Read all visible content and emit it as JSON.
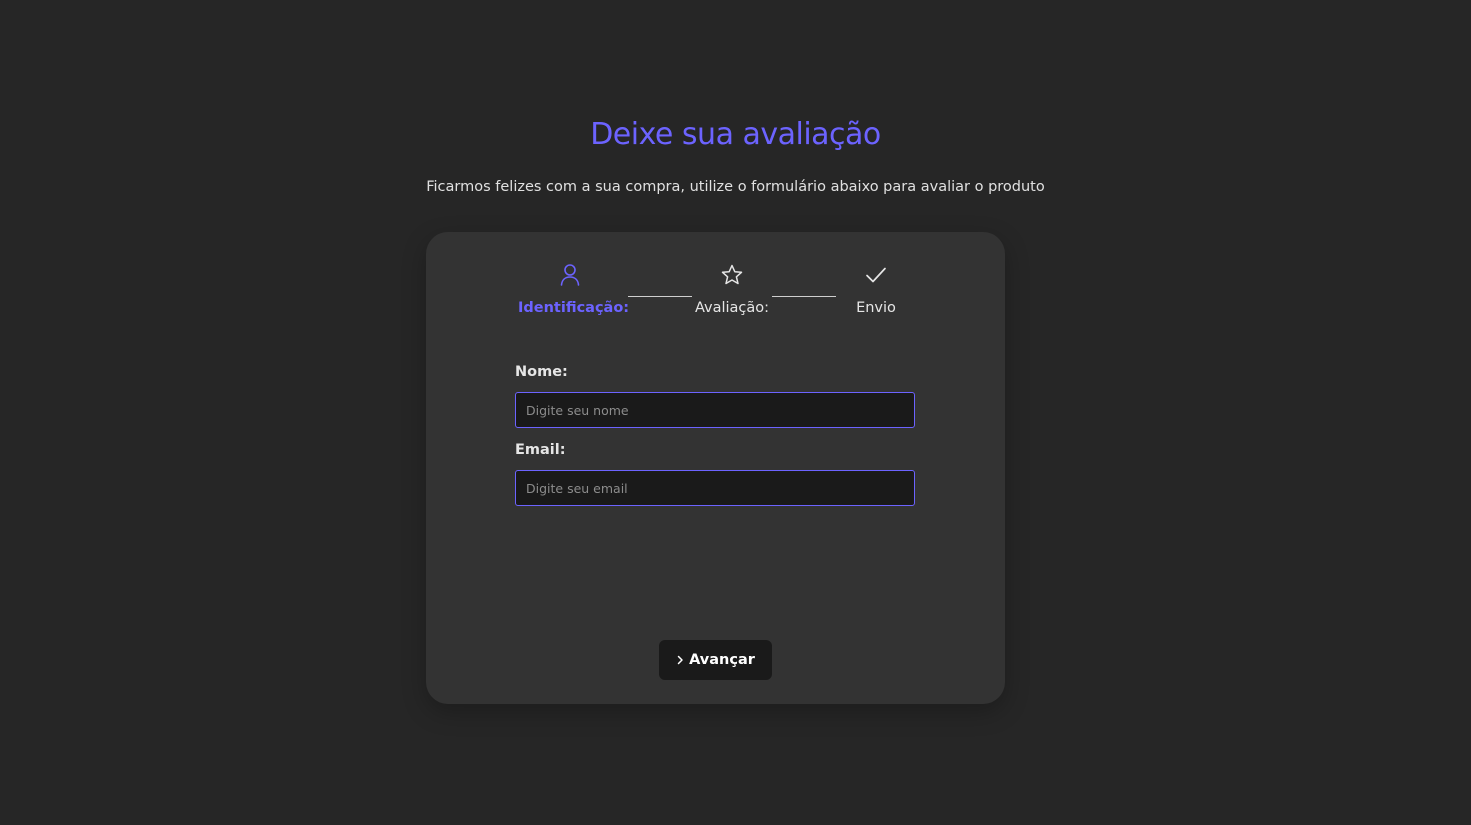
{
  "header": {
    "title": "Deixe sua avaliação",
    "subtitle": "Ficarmos felizes com a sua compra, utilize o formulário abaixo para avaliar o produto"
  },
  "colors": {
    "accent": "#6c63ff",
    "background": "#262626",
    "card": "#333333",
    "input_bg": "#1a1a1a"
  },
  "steps": [
    {
      "label": "Identificação:",
      "icon": "user-icon",
      "active": true
    },
    {
      "label": "Avaliação:",
      "icon": "star-icon",
      "active": false
    },
    {
      "label": "Envio",
      "icon": "check-icon",
      "active": false
    }
  ],
  "form": {
    "name": {
      "label": "Nome:",
      "placeholder": "Digite seu nome",
      "value": ""
    },
    "email": {
      "label": "Email:",
      "placeholder": "Digite seu email",
      "value": ""
    }
  },
  "actions": {
    "next_label": "Avançar",
    "next_icon": "chevron-right-icon"
  }
}
